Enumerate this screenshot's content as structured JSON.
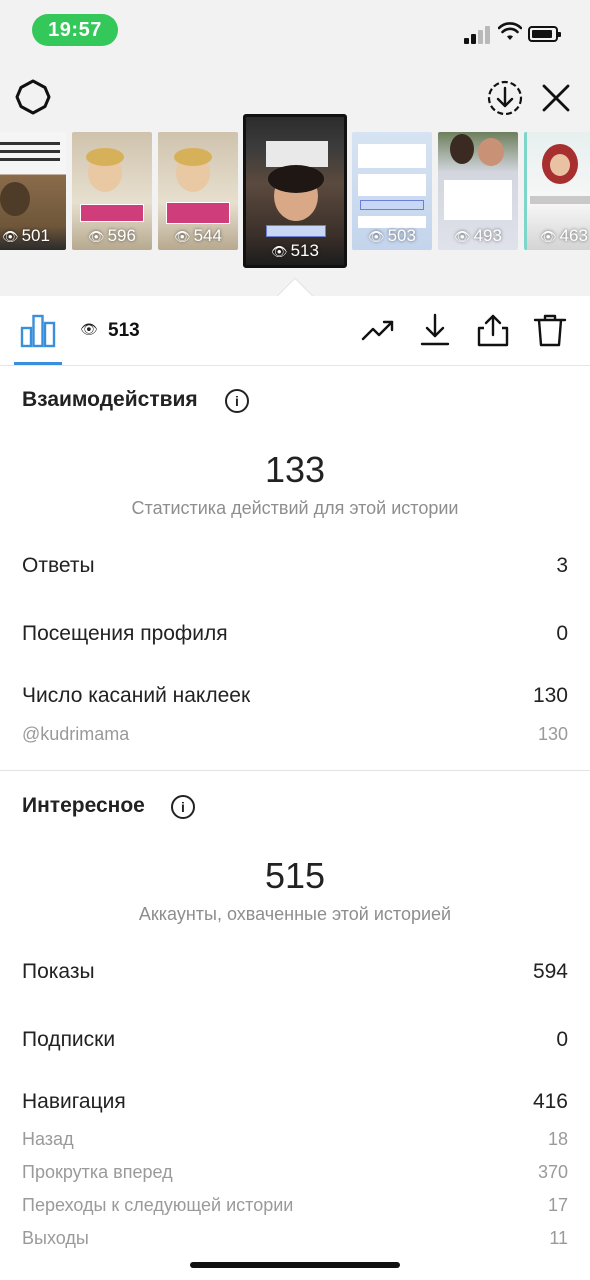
{
  "status_bar": {
    "time": "19:57"
  },
  "thumbnails": [
    {
      "views": "501",
      "eye": "👁",
      "selected": false
    },
    {
      "views": "596",
      "eye": "👁",
      "selected": false
    },
    {
      "views": "544",
      "eye": "👁",
      "selected": false
    },
    {
      "views": "513",
      "eye": "👁",
      "selected": true
    },
    {
      "views": "503",
      "eye": "👁",
      "selected": false
    },
    {
      "views": "493",
      "eye": "👁",
      "selected": false
    },
    {
      "views": "463",
      "eye": "👁",
      "selected": false
    }
  ],
  "toolbar": {
    "eye": "👁",
    "views": "513",
    "icons": [
      "bar-chart-icon",
      "trending-icon",
      "download-icon",
      "share-icon",
      "trash-icon"
    ]
  },
  "interactions": {
    "title": "Взаимодействия",
    "info": "i",
    "total": "133",
    "caption": "Статистика действий для этой истории",
    "rows": [
      {
        "label": "Ответы",
        "value": "3"
      },
      {
        "label": "Посещения профиля",
        "value": "0"
      },
      {
        "label": "Число касаний наклеек",
        "value": "130"
      }
    ],
    "sub_rows": [
      {
        "label": "@kudrimama",
        "value": "130"
      }
    ]
  },
  "discovery": {
    "title": "Интересное",
    "info": "i",
    "total": "515",
    "caption": "Аккаунты, охваченные этой историей",
    "rows": [
      {
        "label": "Показы",
        "value": "594"
      },
      {
        "label": "Подписки",
        "value": "0"
      },
      {
        "label": "Навигация",
        "value": "416"
      }
    ],
    "sub_rows": [
      {
        "label": "Назад",
        "value": "18"
      },
      {
        "label": "Прокрутка вперед",
        "value": "370"
      },
      {
        "label": "Переходы к следующей истории",
        "value": "17"
      },
      {
        "label": "Выходы",
        "value": "11"
      }
    ]
  },
  "colors": {
    "accent": "#3a8fdc",
    "status_pill": "#34c759",
    "muted_text": "#8e8e8e"
  }
}
